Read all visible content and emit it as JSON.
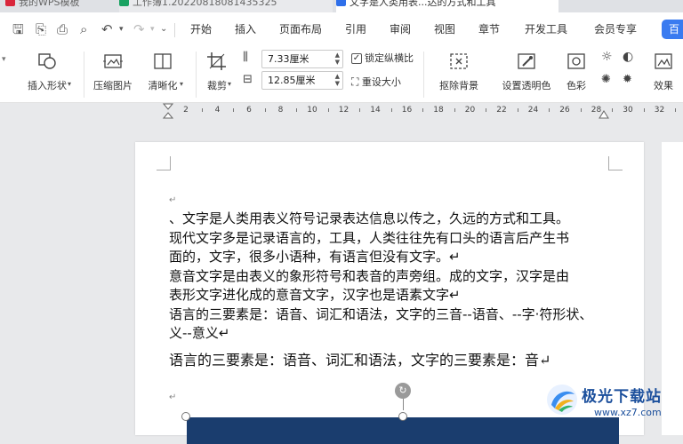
{
  "tabs": [
    {
      "label": "我的WPS模板",
      "icon": "wps-icon",
      "color": "#d9263b"
    },
    {
      "label": "工作簿1.20220818081435325",
      "icon": "sheet-icon",
      "color": "#1aa262"
    },
    {
      "label": "文字是人类用表...达的方式和工具",
      "icon": "doc-icon",
      "color": "#2f6fea"
    }
  ],
  "quick_access": {
    "icons": [
      "save-icon",
      "export-pdf-icon",
      "print-icon",
      "print-preview-icon",
      "undo-icon",
      "undo-dropdown-icon",
      "redo-icon",
      "redo-dropdown-icon",
      "customize-dropdown-icon"
    ]
  },
  "menu": {
    "items": [
      "开始",
      "插入",
      "页面布局",
      "引用",
      "审阅",
      "视图",
      "章节",
      "开发工具",
      "会员专享"
    ],
    "vip_button": "百"
  },
  "ribbon": {
    "insert_shape": "插入形状",
    "compress": "压缩图片",
    "sharpen": "清晰化",
    "crop": "裁剪",
    "width_value": "7.33厘米",
    "height_value": "12.85厘米",
    "lock_ratio": "锁定纵横比",
    "lock_checked": true,
    "reset_size": "重设大小",
    "remove_bg": "抠除背景",
    "set_transparent": "设置透明色",
    "color": "色彩",
    "effects": "效果"
  },
  "ruler": {
    "numbers": [
      "2",
      "4",
      "6",
      "8",
      "10",
      "12",
      "14",
      "16",
      "18",
      "20",
      "22",
      "24",
      "26",
      "28",
      "30",
      "32"
    ]
  },
  "document": {
    "paragraph_mark": "↵",
    "lines": [
      "、文字是人类用表义符号记录表达信息以传之，久远的方式和工具。",
      "现代文字多是记录语言的，工具，人类往往先有口头的语言后产生书",
      "面的，文字，很多小语种，有语言但没有文字。↵",
      "意音文字是由表义的象形符号和表音的声旁组。成的文字，汉字是由",
      "表形文字进化成的意音文字，汉字也是语素文字↵",
      "语言的三要素是：语音、词汇和语法，文字的三音--语音、--字·符形状、",
      "义--意义↵"
    ],
    "serif_line": "语言的三要素是：语音、词汇和语法，文字的三要素是：音↵"
  },
  "watermark": {
    "title": "极光下载站",
    "url": "www.xz7.com"
  },
  "colors": {
    "accent": "#3a7bf0",
    "image_fill": "#1a3d6e",
    "watermark": "#1b4f9c"
  }
}
